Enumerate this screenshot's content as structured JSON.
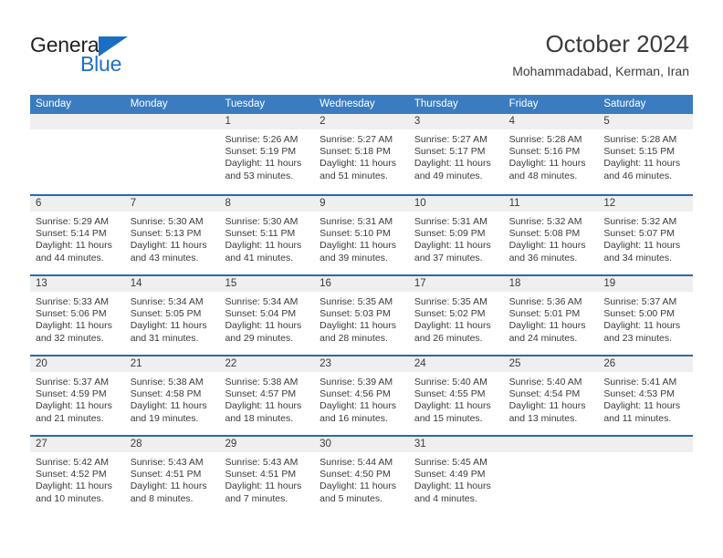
{
  "logo": {
    "primary_text": "General",
    "secondary_text": "Blue",
    "accent_color": "#1b6ec2",
    "triangle_icon": "triangle-icon"
  },
  "header": {
    "title": "October 2024",
    "subtitle": "Mohammadabad, Kerman, Iran"
  },
  "theme": {
    "header_row_bg": "#3b7cc0",
    "week_divider": "#2a6aa8",
    "daynum_band_bg": "#efefef",
    "text_color": "#3a3a3a"
  },
  "calendar": {
    "weekdays": [
      "Sunday",
      "Monday",
      "Tuesday",
      "Wednesday",
      "Thursday",
      "Friday",
      "Saturday"
    ],
    "weeks": [
      [
        {
          "day": "",
          "empty": true
        },
        {
          "day": "",
          "empty": true
        },
        {
          "day": "1",
          "sunrise": "Sunrise: 5:26 AM",
          "sunset": "Sunset: 5:19 PM",
          "daylight_line1": "Daylight: 11 hours",
          "daylight_line2": "and 53 minutes."
        },
        {
          "day": "2",
          "sunrise": "Sunrise: 5:27 AM",
          "sunset": "Sunset: 5:18 PM",
          "daylight_line1": "Daylight: 11 hours",
          "daylight_line2": "and 51 minutes."
        },
        {
          "day": "3",
          "sunrise": "Sunrise: 5:27 AM",
          "sunset": "Sunset: 5:17 PM",
          "daylight_line1": "Daylight: 11 hours",
          "daylight_line2": "and 49 minutes."
        },
        {
          "day": "4",
          "sunrise": "Sunrise: 5:28 AM",
          "sunset": "Sunset: 5:16 PM",
          "daylight_line1": "Daylight: 11 hours",
          "daylight_line2": "and 48 minutes."
        },
        {
          "day": "5",
          "sunrise": "Sunrise: 5:28 AM",
          "sunset": "Sunset: 5:15 PM",
          "daylight_line1": "Daylight: 11 hours",
          "daylight_line2": "and 46 minutes."
        }
      ],
      [
        {
          "day": "6",
          "sunrise": "Sunrise: 5:29 AM",
          "sunset": "Sunset: 5:14 PM",
          "daylight_line1": "Daylight: 11 hours",
          "daylight_line2": "and 44 minutes."
        },
        {
          "day": "7",
          "sunrise": "Sunrise: 5:30 AM",
          "sunset": "Sunset: 5:13 PM",
          "daylight_line1": "Daylight: 11 hours",
          "daylight_line2": "and 43 minutes."
        },
        {
          "day": "8",
          "sunrise": "Sunrise: 5:30 AM",
          "sunset": "Sunset: 5:11 PM",
          "daylight_line1": "Daylight: 11 hours",
          "daylight_line2": "and 41 minutes."
        },
        {
          "day": "9",
          "sunrise": "Sunrise: 5:31 AM",
          "sunset": "Sunset: 5:10 PM",
          "daylight_line1": "Daylight: 11 hours",
          "daylight_line2": "and 39 minutes."
        },
        {
          "day": "10",
          "sunrise": "Sunrise: 5:31 AM",
          "sunset": "Sunset: 5:09 PM",
          "daylight_line1": "Daylight: 11 hours",
          "daylight_line2": "and 37 minutes."
        },
        {
          "day": "11",
          "sunrise": "Sunrise: 5:32 AM",
          "sunset": "Sunset: 5:08 PM",
          "daylight_line1": "Daylight: 11 hours",
          "daylight_line2": "and 36 minutes."
        },
        {
          "day": "12",
          "sunrise": "Sunrise: 5:32 AM",
          "sunset": "Sunset: 5:07 PM",
          "daylight_line1": "Daylight: 11 hours",
          "daylight_line2": "and 34 minutes."
        }
      ],
      [
        {
          "day": "13",
          "sunrise": "Sunrise: 5:33 AM",
          "sunset": "Sunset: 5:06 PM",
          "daylight_line1": "Daylight: 11 hours",
          "daylight_line2": "and 32 minutes."
        },
        {
          "day": "14",
          "sunrise": "Sunrise: 5:34 AM",
          "sunset": "Sunset: 5:05 PM",
          "daylight_line1": "Daylight: 11 hours",
          "daylight_line2": "and 31 minutes."
        },
        {
          "day": "15",
          "sunrise": "Sunrise: 5:34 AM",
          "sunset": "Sunset: 5:04 PM",
          "daylight_line1": "Daylight: 11 hours",
          "daylight_line2": "and 29 minutes."
        },
        {
          "day": "16",
          "sunrise": "Sunrise: 5:35 AM",
          "sunset": "Sunset: 5:03 PM",
          "daylight_line1": "Daylight: 11 hours",
          "daylight_line2": "and 28 minutes."
        },
        {
          "day": "17",
          "sunrise": "Sunrise: 5:35 AM",
          "sunset": "Sunset: 5:02 PM",
          "daylight_line1": "Daylight: 11 hours",
          "daylight_line2": "and 26 minutes."
        },
        {
          "day": "18",
          "sunrise": "Sunrise: 5:36 AM",
          "sunset": "Sunset: 5:01 PM",
          "daylight_line1": "Daylight: 11 hours",
          "daylight_line2": "and 24 minutes."
        },
        {
          "day": "19",
          "sunrise": "Sunrise: 5:37 AM",
          "sunset": "Sunset: 5:00 PM",
          "daylight_line1": "Daylight: 11 hours",
          "daylight_line2": "and 23 minutes."
        }
      ],
      [
        {
          "day": "20",
          "sunrise": "Sunrise: 5:37 AM",
          "sunset": "Sunset: 4:59 PM",
          "daylight_line1": "Daylight: 11 hours",
          "daylight_line2": "and 21 minutes."
        },
        {
          "day": "21",
          "sunrise": "Sunrise: 5:38 AM",
          "sunset": "Sunset: 4:58 PM",
          "daylight_line1": "Daylight: 11 hours",
          "daylight_line2": "and 19 minutes."
        },
        {
          "day": "22",
          "sunrise": "Sunrise: 5:38 AM",
          "sunset": "Sunset: 4:57 PM",
          "daylight_line1": "Daylight: 11 hours",
          "daylight_line2": "and 18 minutes."
        },
        {
          "day": "23",
          "sunrise": "Sunrise: 5:39 AM",
          "sunset": "Sunset: 4:56 PM",
          "daylight_line1": "Daylight: 11 hours",
          "daylight_line2": "and 16 minutes."
        },
        {
          "day": "24",
          "sunrise": "Sunrise: 5:40 AM",
          "sunset": "Sunset: 4:55 PM",
          "daylight_line1": "Daylight: 11 hours",
          "daylight_line2": "and 15 minutes."
        },
        {
          "day": "25",
          "sunrise": "Sunrise: 5:40 AM",
          "sunset": "Sunset: 4:54 PM",
          "daylight_line1": "Daylight: 11 hours",
          "daylight_line2": "and 13 minutes."
        },
        {
          "day": "26",
          "sunrise": "Sunrise: 5:41 AM",
          "sunset": "Sunset: 4:53 PM",
          "daylight_line1": "Daylight: 11 hours",
          "daylight_line2": "and 11 minutes."
        }
      ],
      [
        {
          "day": "27",
          "sunrise": "Sunrise: 5:42 AM",
          "sunset": "Sunset: 4:52 PM",
          "daylight_line1": "Daylight: 11 hours",
          "daylight_line2": "and 10 minutes."
        },
        {
          "day": "28",
          "sunrise": "Sunrise: 5:43 AM",
          "sunset": "Sunset: 4:51 PM",
          "daylight_line1": "Daylight: 11 hours",
          "daylight_line2": "and 8 minutes."
        },
        {
          "day": "29",
          "sunrise": "Sunrise: 5:43 AM",
          "sunset": "Sunset: 4:51 PM",
          "daylight_line1": "Daylight: 11 hours",
          "daylight_line2": "and 7 minutes."
        },
        {
          "day": "30",
          "sunrise": "Sunrise: 5:44 AM",
          "sunset": "Sunset: 4:50 PM",
          "daylight_line1": "Daylight: 11 hours",
          "daylight_line2": "and 5 minutes."
        },
        {
          "day": "31",
          "sunrise": "Sunrise: 5:45 AM",
          "sunset": "Sunset: 4:49 PM",
          "daylight_line1": "Daylight: 11 hours",
          "daylight_line2": "and 4 minutes."
        },
        {
          "day": "",
          "empty": true
        },
        {
          "day": "",
          "empty": true
        }
      ]
    ]
  }
}
